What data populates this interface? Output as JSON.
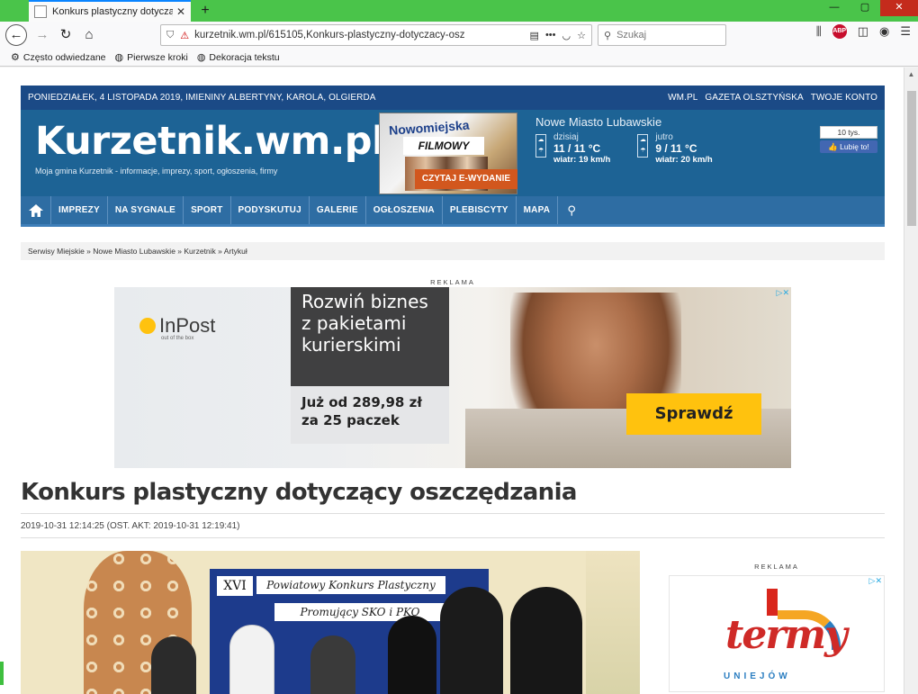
{
  "browser": {
    "tab_title": "Konkurs plastyczny dotyczący oszczędzania",
    "url": "kurzetnik.wm.pl/615105,Konkurs-plastyczny-dotyczacy-osz",
    "search_placeholder": "Szukaj",
    "bookmarks": [
      "Często odwiedzane",
      "Pierwsze kroki",
      "Dekoracja tekstu"
    ]
  },
  "site": {
    "date_line": "PONIEDZIAŁEK, 4 LISTOPADA 2019, IMIENINY ALBERTYNY, KAROLA, OLGIERDA",
    "top_links": [
      "WM.PL",
      "GAZETA OLSZTYŃSKA",
      "TWOJE KONTO"
    ],
    "logo": "Kurzetnik.wm.pl",
    "tagline": "Moja gmina Kurzetnik - informacje, imprezy, sport, ogłoszenia, firmy",
    "ereader_button": "CZYTAJ E-WYDANIE",
    "cover_title": "Nowomiejska",
    "cover_headline": "FILMOWY OBRAZ",
    "weather": {
      "city": "Nowe Miasto Lubawskie",
      "today_label": "dzisiaj",
      "today_temp": "11 / 11 °C",
      "today_wind": "wiatr: 19 km/h",
      "tomorrow_label": "jutro",
      "tomorrow_temp": "9 / 11 °C",
      "tomorrow_wind": "wiatr: 20 km/h"
    },
    "fb": {
      "count": "10 tys.",
      "like": "Lubię to!"
    },
    "nav": [
      "IMPREZY",
      "NA SYGNALE",
      "SPORT",
      "PODYSKUTUJ",
      "GALERIE",
      "OGŁOSZENIA",
      "PLEBISCYTY",
      "MAPA"
    ],
    "breadcrumb": "Serwisy Miejskie » Nowe Miasto Lubawskie » Kurzetnik » Artykuł"
  },
  "ad_label": "REKLAMA",
  "ad1": {
    "brand": "InPost",
    "brand_sub": "out of the box",
    "headline": "Rozwiń biznes z pakietami kurierskimi",
    "price": "Już od 289,98 zł za 25 paczek",
    "cta": "Sprawdź"
  },
  "article": {
    "title": "Konkurs plastyczny dotyczący oszczędzania",
    "dates": "2019-10-31 12:14:25 (OST. AKT: 2019-10-31 12:19:41)",
    "photo_sign": "XVI",
    "photo_banner1": "Powiatowy Konkurs Plastyczny",
    "photo_banner2": "Promujący SKO i PKO"
  },
  "ad2": {
    "brand": "termy",
    "place": "UNIEJÓW"
  }
}
